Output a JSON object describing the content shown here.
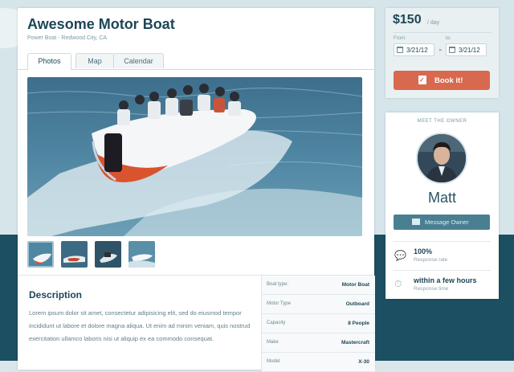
{
  "listing": {
    "title": "Awesome Motor Boat",
    "subtitle": "Power Boat - Redwood City, CA"
  },
  "tabs": [
    {
      "label": "Photos",
      "active": true
    },
    {
      "label": "Map",
      "active": false
    },
    {
      "label": "Calendar",
      "active": false
    }
  ],
  "description": {
    "heading": "Description",
    "body": "Lorem ipsum dolor sit amet, consectetur adipisicing elit, sed do eiusmod tempor incididunt ut labore et dolore magna aliqua. Ut enim ad minim veniam, quis nostrud exercitation ullamco laboris nisi ut aliquip ex ea commodo consequat."
  },
  "specs": [
    {
      "label": "Boat type:",
      "value": "Motor Boat"
    },
    {
      "label": "Motor Type",
      "value": "Outboard"
    },
    {
      "label": "Capacity",
      "value": "8 People"
    },
    {
      "label": "Make",
      "value": "Mastercraft"
    },
    {
      "label": "Model",
      "value": "X-30"
    }
  ],
  "booking": {
    "price": "$150",
    "per": "/ day",
    "from_label": "From:",
    "to_label": "to:",
    "from_date": "3/21/12",
    "to_date": "3/21/12",
    "book_label": "Book it!"
  },
  "owner": {
    "heading": "MEET THE OWNER",
    "name": "Matt",
    "message_label": "Message Owner",
    "response_rate": "100%",
    "response_rate_label": "Response rate",
    "response_time": "within a few hours",
    "response_time_label": "Response time"
  },
  "icons": {
    "book": "calendar-check-icon",
    "message": "envelope-icon",
    "rate": "chat-bubbles-icon",
    "time": "stopwatch-icon"
  },
  "colors": {
    "primary": "#1d4657",
    "accent": "#d9694e",
    "secondary": "#4a7f92",
    "band": "#1c4f61"
  }
}
